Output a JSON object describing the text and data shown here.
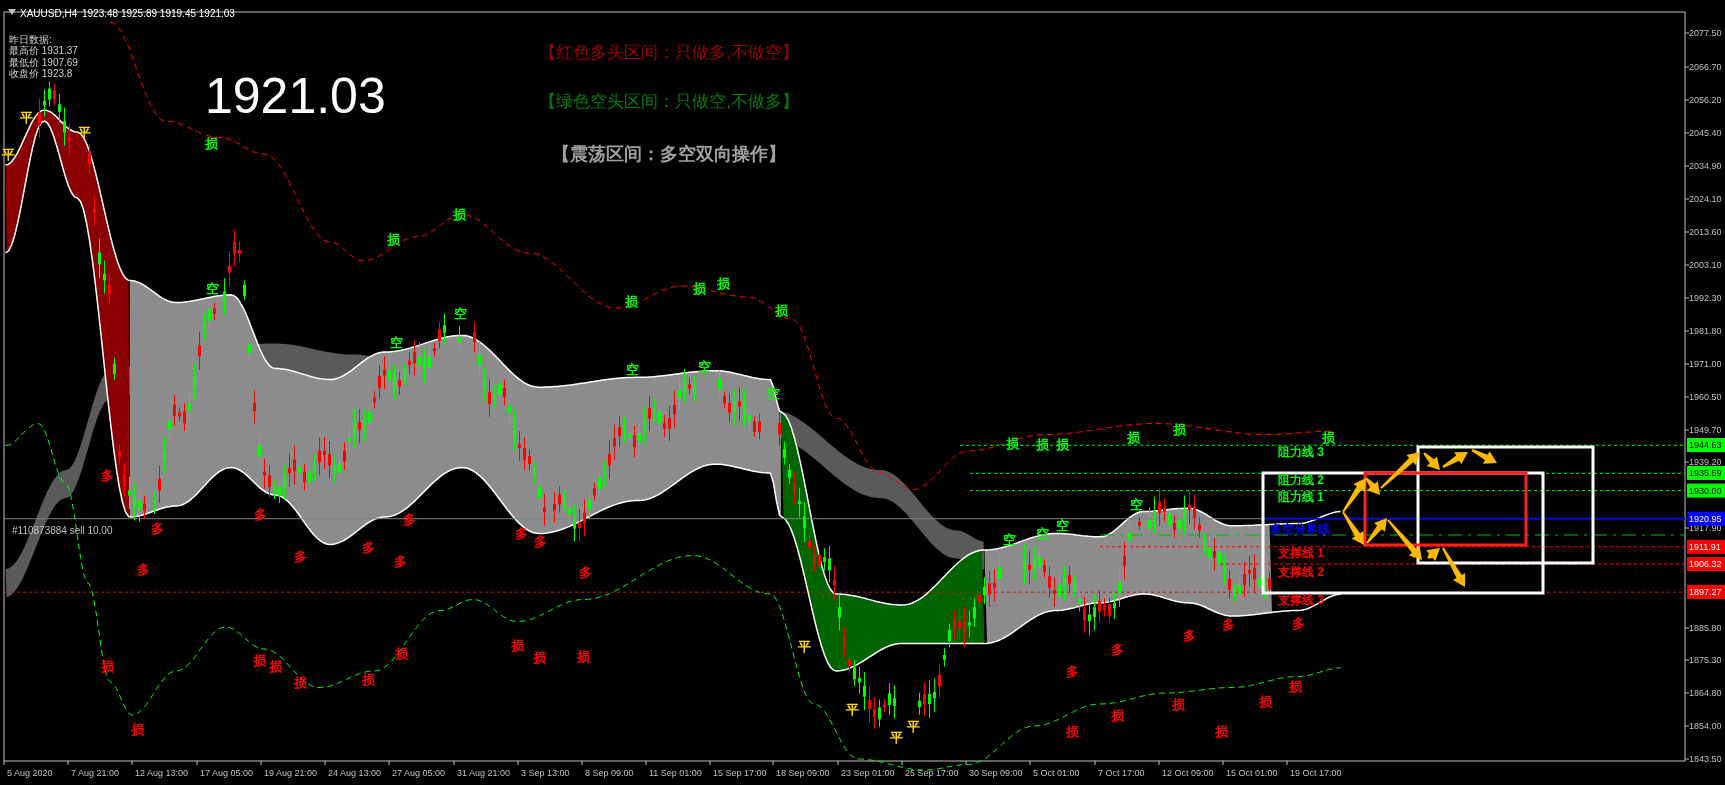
{
  "chart": {
    "header": {
      "title": "XAUUSD,H4",
      "ohlc": "1923.48 1925.89 1919.45 1921.03"
    },
    "yesterday_info": [
      "昨日数据:",
      "最高价 1931.37",
      "最低价 1907.69",
      "收盘价 1923.8"
    ],
    "current_price": "1921.03",
    "legend": [
      {
        "text": "【红色多头区间：只做多,不做空】",
        "color": "#a00000"
      },
      {
        "text": "【绿色空头区间：只做空,不做多】",
        "color": "#008000"
      },
      {
        "text": "【震荡区间：多空双向操作】",
        "color": "#a0a0a0"
      }
    ],
    "price_axis": [
      "2077.50",
      "2066.70",
      "2056.20",
      "2045.40",
      "2034.90",
      "2024.10",
      "2013.60",
      "2003.10",
      "1992.30",
      "1981.80",
      "1971.00",
      "1960.50",
      "1949.70",
      "1939.20",
      "1917.90",
      "1885.80",
      "1875.30",
      "1864.80",
      "1854.00",
      "1843.50"
    ],
    "time_axis": [
      "5 Aug 2020",
      "7 Aug 21:00",
      "12 Aug 13:00",
      "17 Aug 05:00",
      "19 Aug 21:00",
      "24 Aug 13:00",
      "27 Aug 05:00",
      "31 Aug 21:00",
      "3 Sep 13:00",
      "8 Sep 09:00",
      "11 Sep 01:00",
      "15 Sep 17:00",
      "18 Sep 09:00",
      "23 Sep 01:00",
      "25 Sep 17:00",
      "30 Sep 09:00",
      "5 Oct 01:00",
      "7 Oct 17:00",
      "12 Oct 09:00",
      "15 Oct 01:00",
      "19 Oct 17:00"
    ],
    "price_tags": [
      {
        "text": "1944.63",
        "color": "#00ff00"
      },
      {
        "text": "1935.59",
        "color": "#00ff00"
      },
      {
        "text": "1930.00",
        "color": "#00ff00"
      },
      {
        "text": "1920.95",
        "color": "#0000ff"
      },
      {
        "text": "1911.91",
        "color": "#ff0000"
      },
      {
        "text": "1906.32",
        "color": "#ff0000"
      },
      {
        "text": "1897.27",
        "color": "#ff0000"
      }
    ],
    "level_labels": [
      {
        "text": "阻力线 3",
        "color": "#00ff00"
      },
      {
        "text": "阻力线 2",
        "color": "#00ff00"
      },
      {
        "text": "阻力线 1",
        "color": "#00ff00"
      },
      {
        "text": "多空分界线",
        "color": "#0000ff"
      },
      {
        "text": "支撑线 1",
        "color": "#ff0000"
      },
      {
        "text": "支撑线 2",
        "color": "#ff0000"
      },
      {
        "text": "支撑线 3",
        "color": "#ff0000"
      }
    ],
    "order_line": "#110873884 sell 10.00",
    "signals": [
      {
        "text": "平",
        "color": "#ffd700"
      },
      {
        "text": "平",
        "color": "#ffd700"
      },
      {
        "text": "平",
        "color": "#ffd700"
      },
      {
        "text": "损",
        "color": "#00ff00"
      },
      {
        "text": "损",
        "color": "#00ff00"
      },
      {
        "text": "损",
        "color": "#00ff00"
      },
      {
        "text": "损",
        "color": "#00ff00"
      },
      {
        "text": "损",
        "color": "#00ff00"
      },
      {
        "text": "损",
        "color": "#00ff00"
      },
      {
        "text": "损",
        "color": "#00ff00"
      },
      {
        "text": "空",
        "color": "#00ff00"
      },
      {
        "text": "空",
        "color": "#00ff00"
      },
      {
        "text": "空",
        "color": "#00ff00"
      },
      {
        "text": "空",
        "color": "#00ff00"
      },
      {
        "text": "空",
        "color": "#00ff00"
      },
      {
        "text": "空",
        "color": "#00ff00"
      },
      {
        "text": "多",
        "color": "#ff0000"
      },
      {
        "text": "多",
        "color": "#ff0000"
      },
      {
        "text": "多",
        "color": "#ff0000"
      },
      {
        "text": "多",
        "color": "#ff0000"
      },
      {
        "text": "多",
        "color": "#ff0000"
      },
      {
        "text": "多",
        "color": "#ff0000"
      },
      {
        "text": "多",
        "color": "#ff0000"
      },
      {
        "text": "多",
        "color": "#ff0000"
      },
      {
        "text": "多",
        "color": "#ff0000"
      },
      {
        "text": "多",
        "color": "#ff0000"
      },
      {
        "text": "多",
        "color": "#ff0000"
      },
      {
        "text": "损",
        "color": "#ff0000"
      },
      {
        "text": "损",
        "color": "#ff0000"
      },
      {
        "text": "损",
        "color": "#ff0000"
      },
      {
        "text": "损",
        "color": "#ff0000"
      },
      {
        "text": "损",
        "color": "#ff0000"
      },
      {
        "text": "损",
        "color": "#ff0000"
      },
      {
        "text": "损",
        "color": "#ff0000"
      },
      {
        "text": "损",
        "color": "#ff0000"
      },
      {
        "text": "损",
        "color": "#ff0000"
      },
      {
        "text": "损",
        "color": "#ff0000"
      },
      {
        "text": "平",
        "color": "#ffd700"
      },
      {
        "text": "平",
        "color": "#ffd700"
      },
      {
        "text": "平",
        "color": "#ffd700"
      },
      {
        "text": "平",
        "color": "#ffd700"
      },
      {
        "text": "空",
        "color": "#00ff00"
      },
      {
        "text": "空",
        "color": "#00ff00"
      },
      {
        "text": "空",
        "color": "#00ff00"
      },
      {
        "text": "空",
        "color": "#00ff00"
      },
      {
        "text": "损",
        "color": "#00ff00"
      },
      {
        "text": "损",
        "color": "#00ff00"
      },
      {
        "text": "损",
        "color": "#00ff00"
      },
      {
        "text": "损",
        "color": "#00ff00"
      },
      {
        "text": "损",
        "color": "#00ff00"
      },
      {
        "text": "损",
        "color": "#00ff00"
      },
      {
        "text": "多",
        "color": "#ff0000"
      },
      {
        "text": "多",
        "color": "#ff0000"
      },
      {
        "text": "多",
        "color": "#ff0000"
      },
      {
        "text": "多",
        "color": "#ff0000"
      },
      {
        "text": "多",
        "color": "#ff0000"
      },
      {
        "text": "损",
        "color": "#ff0000"
      },
      {
        "text": "损",
        "color": "#ff0000"
      },
      {
        "text": "损",
        "color": "#ff0000"
      },
      {
        "text": "损",
        "color": "#ff0000"
      },
      {
        "text": "损",
        "color": "#ff0000"
      },
      {
        "text": "损",
        "color": "#ff0000"
      }
    ]
  }
}
